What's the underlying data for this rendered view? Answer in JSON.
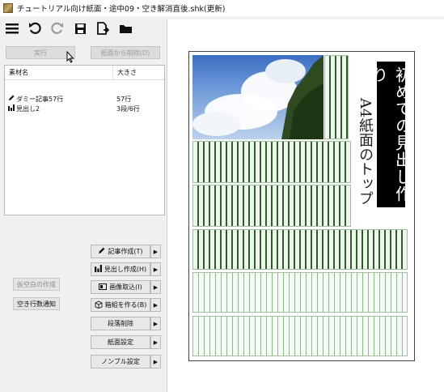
{
  "window": {
    "title": "チュートリアル向け紙面・途中09・空き解消直後.shk(更新)"
  },
  "toolbar": {
    "icons": [
      "menu-icon",
      "undo-icon",
      "redo-icon",
      "save-icon",
      "export-icon",
      "folder-icon"
    ]
  },
  "actions": {
    "execute": "実行",
    "remove_from_page": "紙面から削除(D)"
  },
  "material_list": {
    "headers": {
      "name": "素材名",
      "size": "大きさ"
    },
    "rows": [
      {
        "icon": "pencil-icon",
        "name": "ダミー記事57行",
        "size": "57行"
      },
      {
        "icon": "headline-icon",
        "name": "見出し2",
        "size": "3段/6行"
      }
    ]
  },
  "left_buttons": {
    "fake_blank": "仮空白の作成",
    "notify_blank_lines": "空き行数通知"
  },
  "side_actions": [
    {
      "icon": "pencil-icon",
      "label": "記事作成(T)"
    },
    {
      "icon": "headline-icon",
      "label": "見出し作成(H)"
    },
    {
      "icon": "image-icon",
      "label": "画像取込(I)"
    },
    {
      "icon": "box-icon",
      "label": "箱組を作る(B)"
    },
    {
      "icon": "",
      "label": "段落削除"
    },
    {
      "icon": "",
      "label": "紙面設定"
    },
    {
      "icon": "",
      "label": "ノンブル設定"
    }
  ],
  "page": {
    "headline": "初めての見出し作り",
    "subheadline": "A4紙面のトップ"
  },
  "colors": {
    "accent_green": "#2d5f2d",
    "headline_bg": "#000000"
  }
}
